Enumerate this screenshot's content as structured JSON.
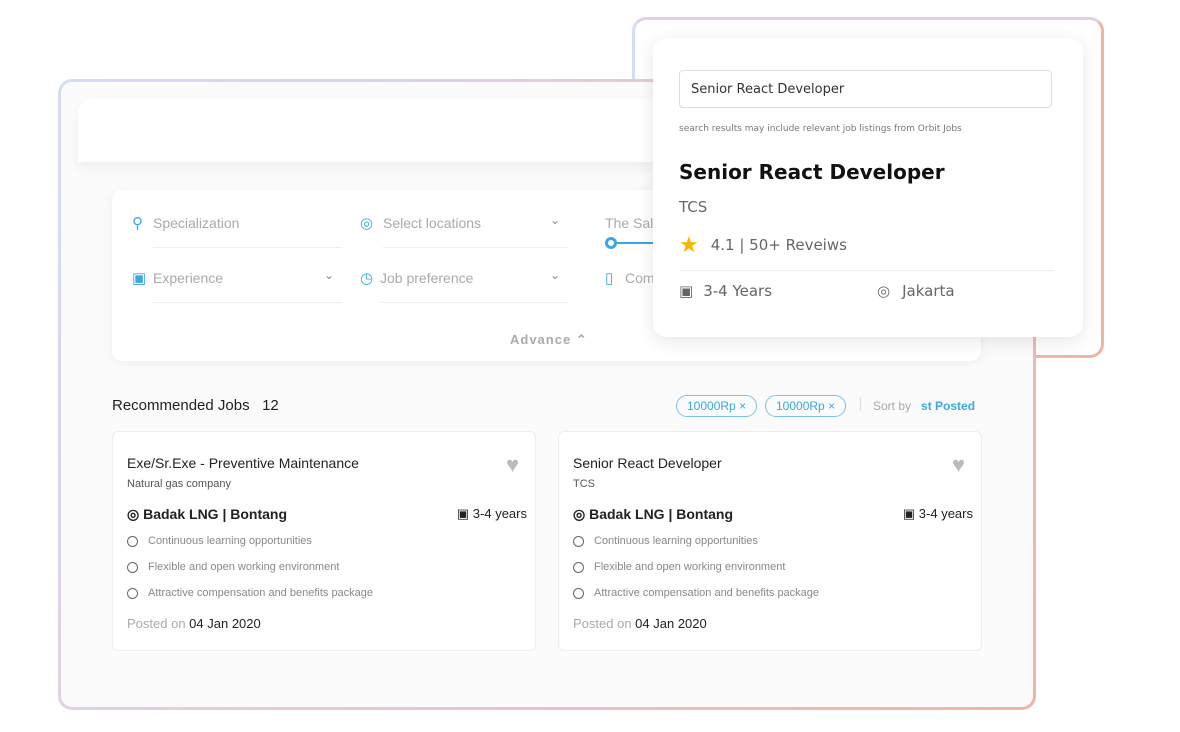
{
  "colors": {
    "accent": "#3aa7e0",
    "star": "#f7b500",
    "frame_start": "#d4dcfb",
    "frame_end": "#f0b4a4"
  },
  "filters": {
    "specialization": "Specialization",
    "locations": "Select locations",
    "salary": "The Sala",
    "experience": "Experience",
    "job_preference": "Job preference",
    "company": "Com",
    "advance": "Advance"
  },
  "recommended": {
    "title": "Recommended Jobs",
    "count": "12"
  },
  "chips": [
    "10000Rp",
    "10000Rp"
  ],
  "sort": {
    "label": "Sort by",
    "value": "st  Posted"
  },
  "jobs": [
    {
      "title": "Exe/Sr.Exe - Preventive Maintenance",
      "company": "Natural gas company",
      "location": "Badak LNG |  Bontang",
      "experience": "3-4 years",
      "perks": [
        "Continuous learning opportunities",
        "Flexible and open working environment",
        "Attractive compensation and benefits package"
      ],
      "posted_label": "Posted on",
      "posted_date": "04 Jan 2020"
    },
    {
      "title": "Senior React Developer",
      "company": "TCS",
      "location": "Badak LNG |  Bontang",
      "experience": "3-4 years",
      "perks": [
        "Continuous learning opportunities",
        "Flexible and open working environment",
        "Attractive compensation and benefits package"
      ],
      "posted_label": "Posted on",
      "posted_date": "04 Jan 2020"
    }
  ],
  "popup": {
    "search_value": "Senior React Developer",
    "hint": "search results may include relevant job listings from Orbit Jobs",
    "title": "Senior React Developer",
    "company": "TCS",
    "rating": "4.1 | 50+ Reveiws",
    "experience": "3-4 Years",
    "location": "Jakarta"
  }
}
